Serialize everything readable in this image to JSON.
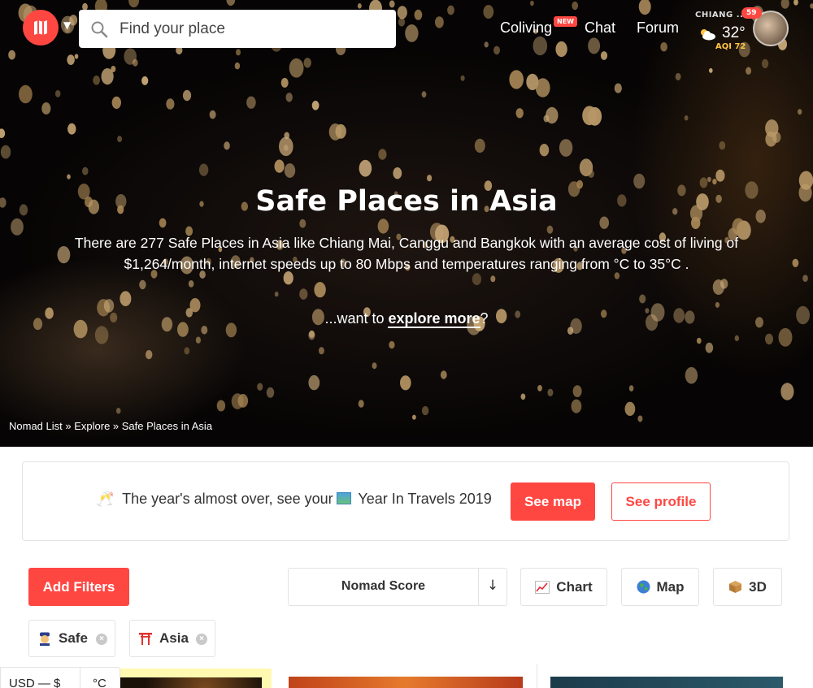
{
  "header": {
    "search_placeholder": "Find your place",
    "nav": {
      "coliving": "Coliving",
      "new_badge": "NEW",
      "chat": "Chat",
      "forum": "Forum"
    },
    "weather": {
      "city": "CHIANG ...",
      "temp": "32°",
      "aqi": "AQI 72",
      "icon": "partly-cloudy-icon"
    },
    "notifications": "59"
  },
  "hero": {
    "title": "Safe Places in Asia",
    "description": "There are 277 Safe Places in Asia like Chiang Mai, Canggu and Bangkok with an average cost of living of $1,264/month, internet speeds up to 80 Mbps and temperatures ranging from °C to 35°C .",
    "explore_prefix": "...want to ",
    "explore_link": "explore more",
    "explore_suffix": "?"
  },
  "breadcrumb": {
    "items": [
      "Nomad List",
      "Explore",
      "Safe Places in Asia"
    ],
    "separator": " » "
  },
  "banner": {
    "emoji_1": "🥂",
    "text_1": "The year's almost over, see your",
    "text_2": "Year In Travels 2019",
    "see_map": "See map",
    "see_profile": "See profile"
  },
  "filters": {
    "add_filters": "Add Filters",
    "sort_label": "Nomad Score",
    "sort_arrow": "↓",
    "views": {
      "chart": "Chart",
      "map": "Map",
      "three_d": "3D"
    },
    "tags": [
      {
        "label": "Safe",
        "icon": "police-officer-icon"
      },
      {
        "label": "Asia",
        "icon": "torii-gate-icon"
      }
    ]
  },
  "prefs": {
    "currency": "USD — $",
    "temp_unit": "°C"
  },
  "colors": {
    "accent": "#ff4742",
    "aqi": "#ffc542"
  }
}
